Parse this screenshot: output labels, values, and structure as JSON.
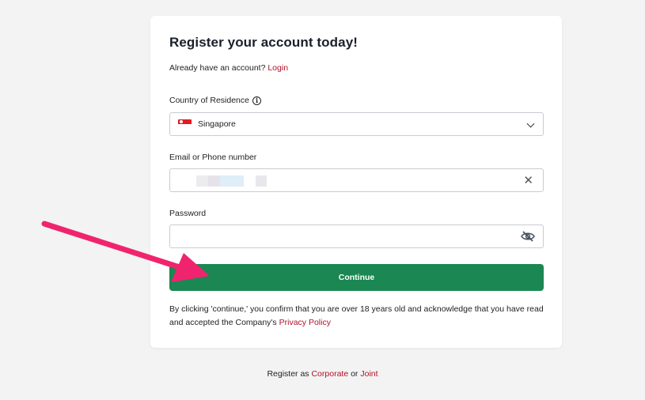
{
  "header": {
    "title": "Register your account today!",
    "already_text": "Already have an account?",
    "login_link": "Login"
  },
  "form": {
    "country": {
      "label": "Country of Residence",
      "value": "Singapore",
      "flag": "singapore-flag"
    },
    "email": {
      "label": "Email or Phone number",
      "value": ""
    },
    "password": {
      "label": "Password",
      "value": ""
    },
    "continue_label": "Continue"
  },
  "disclaimer": {
    "text": "By clicking 'continue,' you confirm that you are over 18 years old and acknowledge that you have read and accepted the Company's",
    "policy_link": "Privacy Policy"
  },
  "footer": {
    "prefix": "Register as",
    "corporate_link": "Corporate",
    "or_text": "or",
    "joint_link": "Joint"
  },
  "colors": {
    "accent_red": "#b0102a",
    "button_green": "#1b8752",
    "arrow_pink": "#f0246e"
  }
}
